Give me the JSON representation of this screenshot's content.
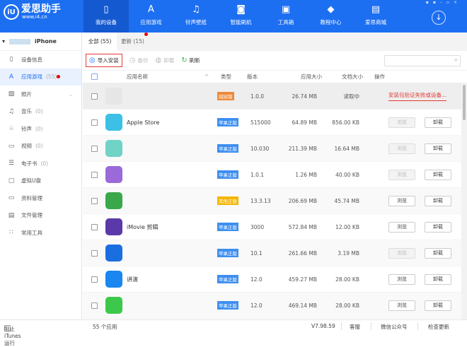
{
  "header": {
    "logo_title": "爱思助手",
    "logo_url": "www.i4.cn",
    "logo_mark": "iU",
    "nav": [
      {
        "label": "我的设备",
        "icon": "phone-icon"
      },
      {
        "label": "应用游戏",
        "icon": "app-store-icon"
      },
      {
        "label": "铃声壁纸",
        "icon": "music-icon"
      },
      {
        "label": "智能刷机",
        "icon": "flash-icon"
      },
      {
        "label": "工具箱",
        "icon": "toolbox-icon"
      },
      {
        "label": "教程中心",
        "icon": "graduation-cap-icon"
      },
      {
        "label": "爱思商城",
        "icon": "shop-icon"
      }
    ]
  },
  "sidebar": {
    "device_name": "iPhone",
    "items": [
      {
        "label": "设备信息",
        "count": "",
        "icon": "device-icon"
      },
      {
        "label": "应用游戏",
        "count": "(55)",
        "icon": "app-icon"
      },
      {
        "label": "照片",
        "count": "",
        "icon": "photo-icon"
      },
      {
        "label": "音乐",
        "count": "(0)",
        "icon": "music-icon"
      },
      {
        "label": "铃声",
        "count": "(0)",
        "icon": "bell-icon"
      },
      {
        "label": "视频",
        "count": "(0)",
        "icon": "video-icon"
      },
      {
        "label": "电子书",
        "count": "(0)",
        "icon": "book-icon"
      },
      {
        "label": "虚拟U盘",
        "count": "",
        "icon": "usb-icon"
      },
      {
        "label": "资料管理",
        "count": "",
        "icon": "folder-icon"
      },
      {
        "label": "文件管理",
        "count": "",
        "icon": "file-icon"
      },
      {
        "label": "常用工具",
        "count": "",
        "icon": "grid-icon"
      }
    ]
  },
  "tabs": [
    {
      "label": "全部 (55)"
    },
    {
      "label": "更新 (15)"
    }
  ],
  "toolbar": {
    "import": "导入安装",
    "backup": "备份",
    "uninstall": "卸载",
    "refresh": "刷新",
    "search_placeholder": ""
  },
  "columns": {
    "name": "应用名称",
    "type": "类型",
    "version": "版本",
    "app_size": "应用大小",
    "doc_size": "文档大小",
    "action": "操作"
  },
  "colors": {
    "blue": "#1d6ff2",
    "apple_badge": "#3d8ef0",
    "jailbreak_badge": "#f0883a",
    "other_badge": "#f5b400"
  },
  "rows": [
    {
      "name": "",
      "type": "越狱版",
      "badge": "#f0883a",
      "version": "1.0.0",
      "app_size": "26.74 MB",
      "doc_size": "读取中",
      "error": "安装包验证失败或设备...",
      "icon_color": "#e6e6e6"
    },
    {
      "name": "Apple Store",
      "type": "苹果正版",
      "badge": "#3d8ef0",
      "version": "515000",
      "app_size": "64.89 MB",
      "doc_size": "856.00 KB",
      "browse": "浏览",
      "browse_disabled": true,
      "uninstall": "卸载",
      "icon_color": "#3cc0e6"
    },
    {
      "name": "",
      "type": "苹果正版",
      "badge": "#3d8ef0",
      "version": "10.030",
      "app_size": "211.39 MB",
      "doc_size": "16.64 MB",
      "browse": "浏览",
      "browse_disabled": true,
      "uninstall": "卸载",
      "icon_color": "#6fd3c6"
    },
    {
      "name": "",
      "type": "苹果正版",
      "badge": "#3d8ef0",
      "version": "1.0.1",
      "app_size": "1.26 MB",
      "doc_size": "40.00 KB",
      "browse": "浏览",
      "browse_disabled": true,
      "uninstall": "卸载",
      "icon_color": "#9a6ad8"
    },
    {
      "name": "",
      "type": "其他正版",
      "badge": "#f5b400",
      "version": "13.3.13",
      "app_size": "206.69 MB",
      "doc_size": "45.74 MB",
      "browse": "浏览",
      "browse_disabled": false,
      "uninstall": "卸载",
      "icon_color": "#3aa84a"
    },
    {
      "name": "iMovie 剪辑",
      "type": "苹果正版",
      "badge": "#3d8ef0",
      "version": "3000",
      "app_size": "572.84 MB",
      "doc_size": "12.00 KB",
      "browse": "浏览",
      "browse_disabled": false,
      "uninstall": "卸载",
      "icon_color": "#5a3aa8"
    },
    {
      "name": "",
      "type": "苹果正版",
      "badge": "#3d8ef0",
      "version": "10.1",
      "app_size": "261.66 MB",
      "doc_size": "3.19 MB",
      "browse": "浏览",
      "browse_disabled": true,
      "uninstall": "卸载",
      "icon_color": "#1a6ee0"
    },
    {
      "name": "讲演",
      "type": "苹果正版",
      "badge": "#3d8ef0",
      "version": "12.0",
      "app_size": "459.27 MB",
      "doc_size": "28.00 KB",
      "browse": "浏览",
      "browse_disabled": false,
      "uninstall": "卸载",
      "icon_color": "#1a86f0"
    },
    {
      "name": "",
      "type": "苹果正版",
      "badge": "#3d8ef0",
      "version": "12.0",
      "app_size": "469.14 MB",
      "doc_size": "28.00 KB",
      "browse": "浏览",
      "browse_disabled": false,
      "uninstall": "卸载",
      "icon_color": "#3cc84a"
    }
  ],
  "footer": {
    "block_itunes": "阻止iTunes运行",
    "app_count": "55 个应用",
    "version": "V7.98.59",
    "service": "客服",
    "wechat": "微信公众号",
    "check_update": "检查更新"
  }
}
